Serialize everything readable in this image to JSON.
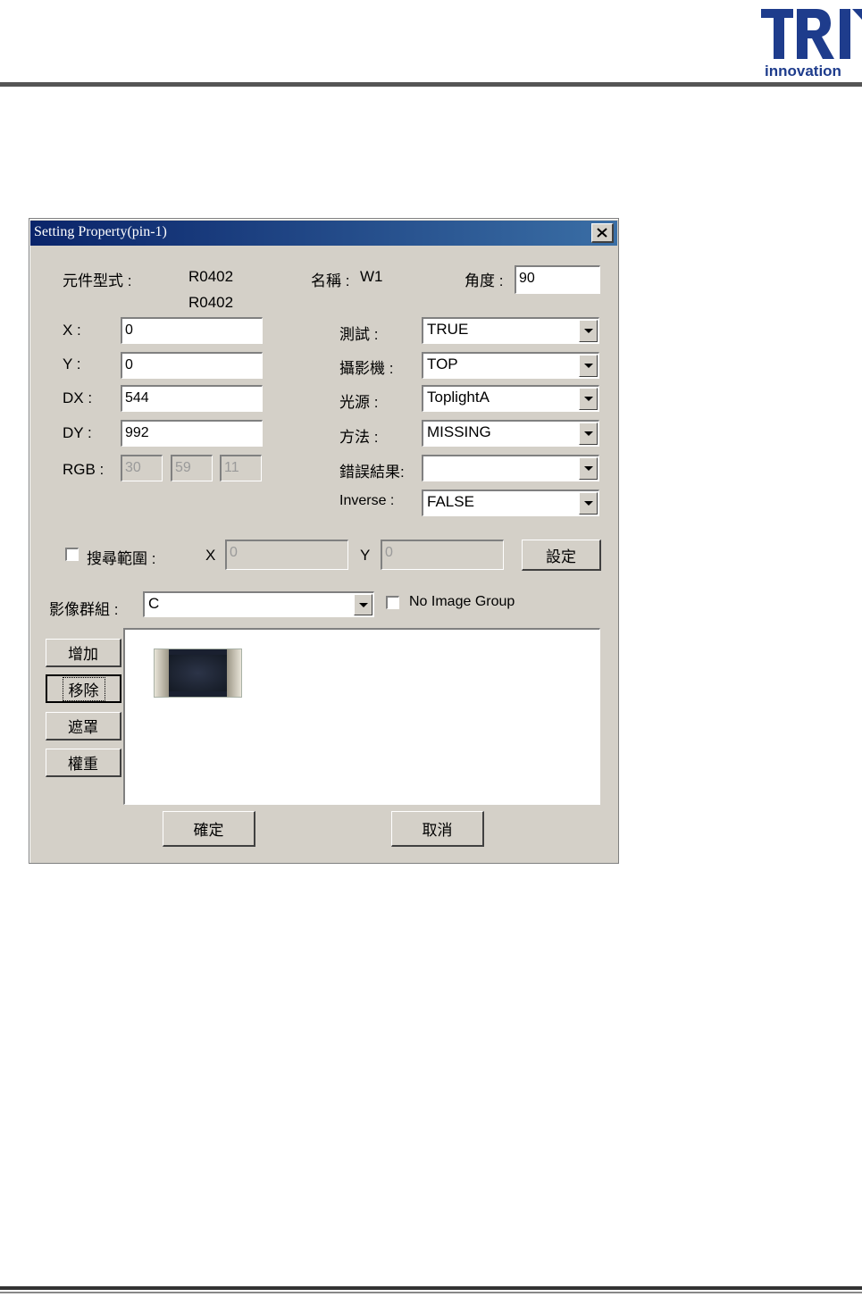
{
  "header": {
    "logo_text": "TRI",
    "logo_sub": "innovation"
  },
  "dialog": {
    "title": "Setting Property(pin-1)",
    "component_type_label": "元件型式 :",
    "component_type_value1": "R0402",
    "component_type_value2": "R0402",
    "name_label": "名稱 :",
    "name_value": "W1",
    "angle_label": "角度 :",
    "angle_value": "90",
    "x_label": "X :",
    "x_value": "0",
    "y_label": "Y :",
    "y_value": "0",
    "dx_label": "DX :",
    "dx_value": "544",
    "dy_label": "DY :",
    "dy_value": "992",
    "rgb_label": "RGB :",
    "rgb_r": "30",
    "rgb_g": "59",
    "rgb_b": "11",
    "test_label": "測試 :",
    "test_value": "TRUE",
    "camera_label": "攝影機 :",
    "camera_value": "TOP",
    "light_label": "光源 :",
    "light_value": "ToplightA",
    "method_label": "方法 :",
    "method_value": "MISSING",
    "error_label": "錯誤結果:",
    "error_value": "",
    "inverse_label": "Inverse :",
    "inverse_value": "FALSE",
    "search_range_label": "搜尋範圍 :",
    "search_x_label": "X",
    "search_x_value": "0",
    "search_y_label": "Y",
    "search_y_value": "0",
    "set_button": "設定",
    "image_group_label": "影像群組 :",
    "image_group_value": "C",
    "no_image_group_label": "No Image Group",
    "add_button": "增加",
    "remove_button": "移除",
    "mask_button": "遮罩",
    "weight_button": "權重",
    "ok_button": "確定",
    "cancel_button": "取消"
  }
}
